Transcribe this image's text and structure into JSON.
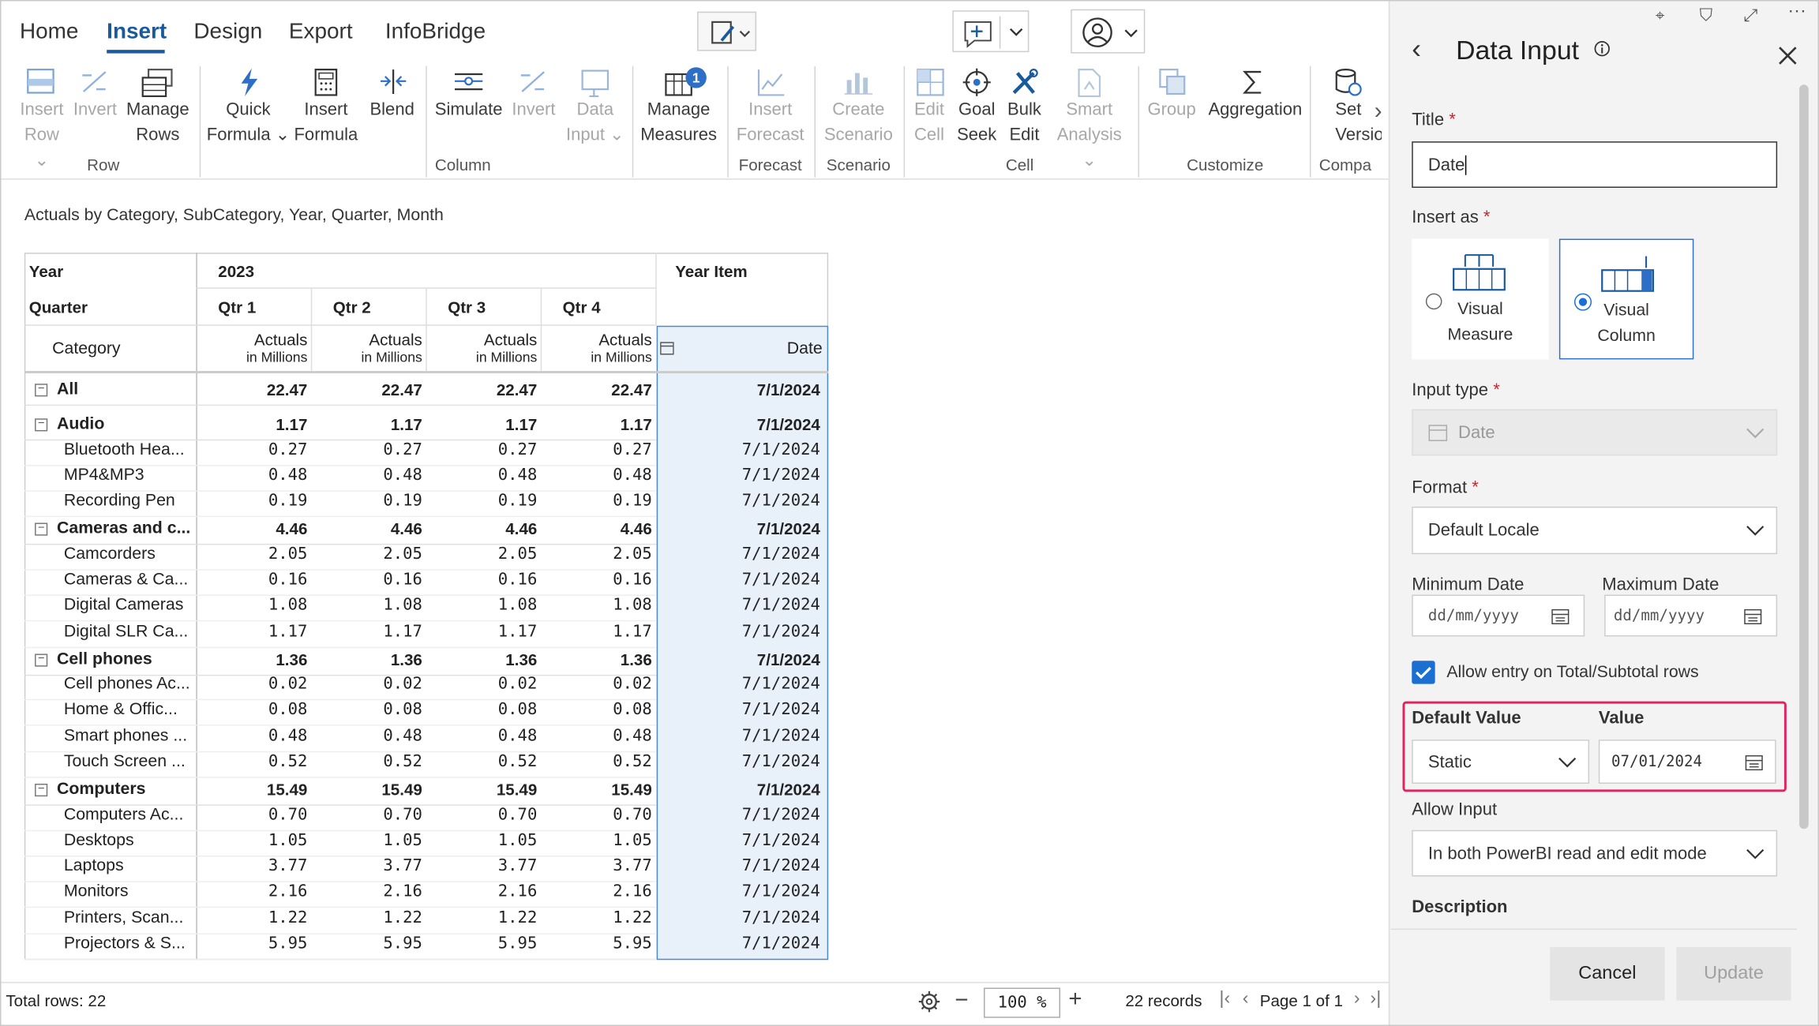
{
  "menu": {
    "home": "Home",
    "insert": "Insert",
    "design": "Design",
    "export": "Export",
    "infobridge": "InfoBridge"
  },
  "ribbon": {
    "insert_row": [
      "Insert",
      "Row ⌄"
    ],
    "invert1": [
      "Invert",
      ""
    ],
    "manage_rows": [
      "Manage",
      "Rows"
    ],
    "quick_formula": [
      "Quick",
      "Formula ⌄"
    ],
    "insert_formula": [
      "Insert",
      "Formula"
    ],
    "blend": [
      "Blend",
      ""
    ],
    "simulate": [
      "Simulate",
      ""
    ],
    "invert2": [
      "Invert",
      ""
    ],
    "data_input": [
      "Data",
      "Input ⌄"
    ],
    "manage_measures": [
      "Manage",
      "Measures"
    ],
    "measures_badge": "1",
    "insert_forecast": [
      "Insert",
      "Forecast"
    ],
    "create_scenario": [
      "Create",
      "Scenario"
    ],
    "edit_cell": [
      "Edit",
      "Cell"
    ],
    "goal_seek": [
      "Goal",
      "Seek"
    ],
    "bulk_edit": [
      "Bulk",
      "Edit"
    ],
    "smart_analysis": [
      "Smart",
      "Analysis ⌄"
    ],
    "group": [
      "Group",
      ""
    ],
    "aggregation": [
      "Aggregation",
      ""
    ],
    "set_version": [
      "Set",
      "Versio"
    ],
    "groups": {
      "row": "Row",
      "column": "Column",
      "forecast": "Forecast",
      "scenario": "Scenario",
      "cell": "Cell",
      "customize": "Customize",
      "compare": "Compa"
    }
  },
  "report": {
    "title": "Actuals by Category, SubCategory, Year, Quarter, Month"
  },
  "table": {
    "h_year": "Year",
    "h_quarter": "Quarter",
    "h_category": "Category",
    "year_val": "2023",
    "year_item": "Year Item",
    "quarters": [
      "Qtr 1",
      "Qtr 2",
      "Qtr 3",
      "Qtr 4"
    ],
    "actuals": "Actuals",
    "in_millions": "in Millions",
    "date_col": "Date",
    "rows": [
      {
        "label": "All",
        "level": 0,
        "v": [
          "22.47",
          "22.47",
          "22.47",
          "22.47"
        ],
        "d": "7/1/2024"
      },
      {
        "label": "Audio",
        "level": 0,
        "v": [
          "1.17",
          "1.17",
          "1.17",
          "1.17"
        ],
        "d": "7/1/2024"
      },
      {
        "label": "Bluetooth Hea...",
        "level": 1,
        "v": [
          "0.27",
          "0.27",
          "0.27",
          "0.27"
        ],
        "d": "7/1/2024"
      },
      {
        "label": "MP4&MP3",
        "level": 1,
        "v": [
          "0.48",
          "0.48",
          "0.48",
          "0.48"
        ],
        "d": "7/1/2024"
      },
      {
        "label": "Recording Pen",
        "level": 1,
        "v": [
          "0.19",
          "0.19",
          "0.19",
          "0.19"
        ],
        "d": "7/1/2024"
      },
      {
        "label": "Cameras and c...",
        "level": 0,
        "v": [
          "4.46",
          "4.46",
          "4.46",
          "4.46"
        ],
        "d": "7/1/2024"
      },
      {
        "label": "Camcorders",
        "level": 1,
        "v": [
          "2.05",
          "2.05",
          "2.05",
          "2.05"
        ],
        "d": "7/1/2024"
      },
      {
        "label": "Cameras & Ca...",
        "level": 1,
        "v": [
          "0.16",
          "0.16",
          "0.16",
          "0.16"
        ],
        "d": "7/1/2024"
      },
      {
        "label": "Digital Cameras",
        "level": 1,
        "v": [
          "1.08",
          "1.08",
          "1.08",
          "1.08"
        ],
        "d": "7/1/2024"
      },
      {
        "label": "Digital SLR Ca...",
        "level": 1,
        "v": [
          "1.17",
          "1.17",
          "1.17",
          "1.17"
        ],
        "d": "7/1/2024"
      },
      {
        "label": "Cell phones",
        "level": 0,
        "v": [
          "1.36",
          "1.36",
          "1.36",
          "1.36"
        ],
        "d": "7/1/2024"
      },
      {
        "label": "Cell phones Ac...",
        "level": 1,
        "v": [
          "0.02",
          "0.02",
          "0.02",
          "0.02"
        ],
        "d": "7/1/2024"
      },
      {
        "label": "Home & Offic...",
        "level": 1,
        "v": [
          "0.08",
          "0.08",
          "0.08",
          "0.08"
        ],
        "d": "7/1/2024"
      },
      {
        "label": "Smart phones ...",
        "level": 1,
        "v": [
          "0.48",
          "0.48",
          "0.48",
          "0.48"
        ],
        "d": "7/1/2024"
      },
      {
        "label": "Touch Screen ...",
        "level": 1,
        "v": [
          "0.52",
          "0.52",
          "0.52",
          "0.52"
        ],
        "d": "7/1/2024"
      },
      {
        "label": "Computers",
        "level": 0,
        "v": [
          "15.49",
          "15.49",
          "15.49",
          "15.49"
        ],
        "d": "7/1/2024"
      },
      {
        "label": "Computers Ac...",
        "level": 1,
        "v": [
          "0.70",
          "0.70",
          "0.70",
          "0.70"
        ],
        "d": "7/1/2024"
      },
      {
        "label": "Desktops",
        "level": 1,
        "v": [
          "1.05",
          "1.05",
          "1.05",
          "1.05"
        ],
        "d": "7/1/2024"
      },
      {
        "label": "Laptops",
        "level": 1,
        "v": [
          "3.77",
          "3.77",
          "3.77",
          "3.77"
        ],
        "d": "7/1/2024"
      },
      {
        "label": "Monitors",
        "level": 1,
        "v": [
          "2.16",
          "2.16",
          "2.16",
          "2.16"
        ],
        "d": "7/1/2024"
      },
      {
        "label": "Printers, Scan...",
        "level": 1,
        "v": [
          "1.22",
          "1.22",
          "1.22",
          "1.22"
        ],
        "d": "7/1/2024"
      },
      {
        "label": "Projectors & S...",
        "level": 1,
        "v": [
          "5.95",
          "5.95",
          "5.95",
          "5.95"
        ],
        "d": "7/1/2024"
      }
    ]
  },
  "status": {
    "total_rows": "Total rows: 22",
    "zoom": "100 %",
    "records": "22 records",
    "page": "Page 1 of 1"
  },
  "panel": {
    "title": "Data Input",
    "title_label": "Title",
    "title_value": "Date",
    "insert_as": "Insert as",
    "opt_measure": [
      "Visual",
      "Measure"
    ],
    "opt_column": [
      "Visual",
      "Column"
    ],
    "input_type": "Input type",
    "input_type_value": "Date",
    "format": "Format",
    "format_value": "Default Locale",
    "min_date": "Minimum Date",
    "max_date": "Maximum Date",
    "date_placeholder": "dd/mm/yyyy",
    "allow_total": "Allow entry on Total/Subtotal rows",
    "default_value": "Default Value",
    "default_value_sel": "Static",
    "value": "Value",
    "value_date": "07/01/2024",
    "allow_input": "Allow Input",
    "allow_input_value": "In both PowerBI read and edit mode",
    "description": "Description",
    "cancel": "Cancel",
    "update": "Update",
    "colors": {
      "accent": "#1a5a9c",
      "highlight": "#e0245e",
      "check": "#1a6fd1"
    }
  }
}
